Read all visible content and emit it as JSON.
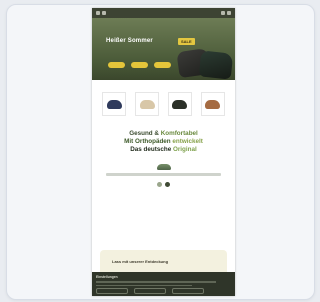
{
  "site": {
    "logo": "",
    "topbar_icons": [
      "menu-icon",
      "search-icon"
    ]
  },
  "hero": {
    "title": "Heißer Sommer",
    "badge": "SALE",
    "buttons": [
      "",
      "",
      ""
    ]
  },
  "products": [
    {
      "name": "",
      "shoe_color": "#2f3a5c"
    },
    {
      "name": "",
      "shoe_color": "#d8c7a8"
    },
    {
      "name": "",
      "shoe_color": "#2b3028"
    },
    {
      "name": "",
      "shoe_color": "#a56b42"
    }
  ],
  "headline": {
    "line1": {
      "a": "Gesund &",
      "b": "Komfortabel"
    },
    "line2": {
      "a": "Mit Orthopäden",
      "b": "entwickelt"
    },
    "line3": {
      "a": "Das deutsche",
      "b": "Original"
    }
  },
  "feature": {
    "title": ""
  },
  "promo": {
    "text": "Lass mit unserer Entdeckung"
  },
  "cookie": {
    "title": "Einstellungen",
    "buttons": [
      "",
      "",
      ""
    ]
  },
  "colors": {
    "topbar": "#3d4333",
    "accent": "#e4c53a",
    "brand_green": "#6a8a3e"
  }
}
